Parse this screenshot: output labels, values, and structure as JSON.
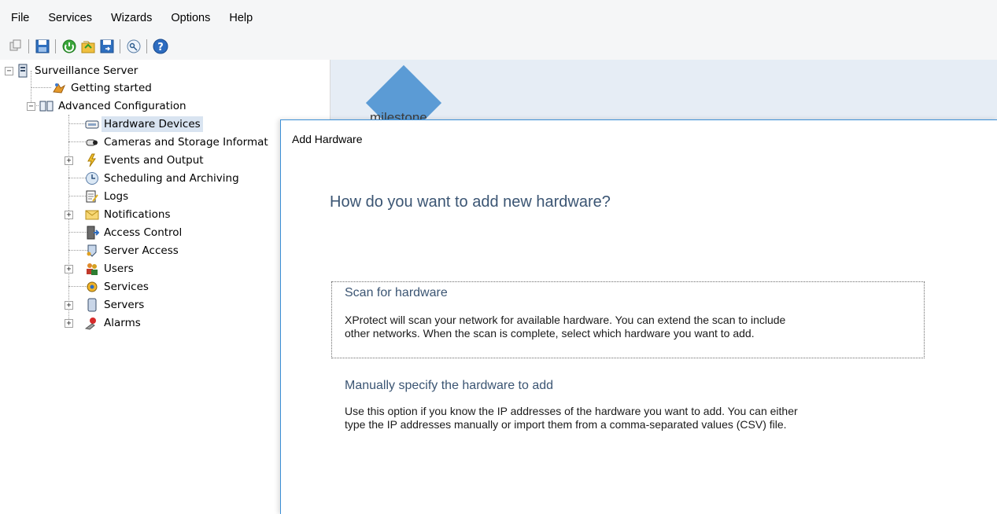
{
  "menu": [
    "File",
    "Services",
    "Wizards",
    "Options",
    "Help"
  ],
  "toolbar": {
    "buttons": [
      "copy-icon",
      "save-icon",
      "refresh-icon",
      "import-icon",
      "export-icon",
      "key-icon",
      "help-icon"
    ]
  },
  "tree": {
    "root": "Surveillance Server",
    "getting_started": "Getting started",
    "advanced": "Advanced Configuration",
    "hardware_devices": "Hardware Devices",
    "cameras_storage": "Cameras and Storage Informat",
    "events_output": "Events and Output",
    "scheduling": "Scheduling and Archiving",
    "logs": "Logs",
    "notifications": "Notifications",
    "access_control": "Access Control",
    "server_access": "Server Access",
    "users": "Users",
    "services": "Services",
    "servers": "Servers",
    "alarms": "Alarms"
  },
  "background": {
    "logo_text": "milestone"
  },
  "dialog": {
    "title": "Add Hardware",
    "question": "How do you want to add new hardware?",
    "scan": {
      "title": "Scan for hardware",
      "desc1": "XProtect will scan your network for available hardware. You can extend the scan to include",
      "desc2": "other networks. When the scan is complete, select which hardware you want to add."
    },
    "manual": {
      "title": "Manually specify the hardware to add",
      "desc1": "Use this option if you know the IP addresses of the hardware you want to add. You can either",
      "desc2": "type the IP addresses manually or import them from a comma-separated values (CSV) file."
    }
  },
  "colors": {
    "accent": "#3c8fd6",
    "heading": "#3b5573",
    "selection": "#d9e4f1"
  }
}
